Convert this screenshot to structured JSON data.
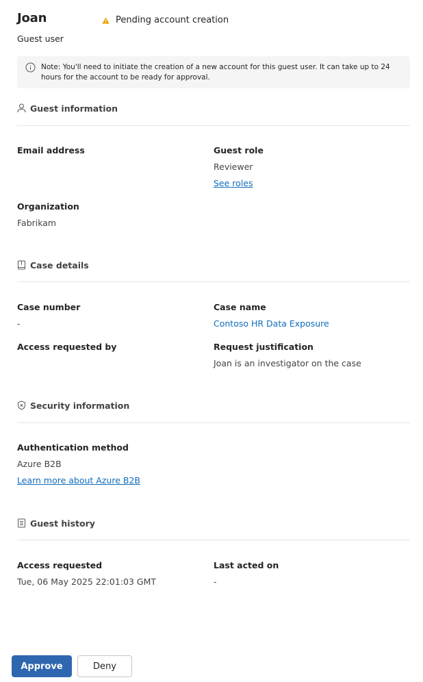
{
  "header": {
    "name": "Joan",
    "status": "Pending account creation",
    "status_icon": "warning-icon",
    "subtitle": "Guest user"
  },
  "notice": {
    "icon": "info-icon",
    "text": "Note: You'll need to initiate the creation of a new account for this guest user. It can take up to 24 hours for the account to be ready for approval."
  },
  "sections": {
    "guest_info": {
      "title": "Guest information",
      "icon": "person-icon",
      "email_label": "Email address",
      "email_value": "",
      "role_label": "Guest role",
      "role_value": "Reviewer",
      "roles_link": "See roles",
      "org_label": "Organization",
      "org_value": "Fabrikam"
    },
    "case_details": {
      "title": "Case details",
      "icon": "book-icon",
      "case_number_label": "Case number",
      "case_number_value": "-",
      "case_name_label": "Case name",
      "case_name_value": "Contoso HR Data Exposure",
      "requested_by_label": "Access requested by",
      "requested_by_value": "",
      "justification_label": "Request justification",
      "justification_value": "Joan is an investigator on the case"
    },
    "security": {
      "title": "Security information",
      "icon": "shield-icon",
      "auth_label": "Authentication method",
      "auth_value": "Azure B2B",
      "learn_more_link": "Learn more about Azure B2B"
    },
    "history": {
      "title": "Guest history",
      "icon": "document-icon",
      "access_requested_label": "Access requested",
      "access_requested_value": "Tue, 06 May 2025 22:01:03 GMT",
      "last_acted_label": "Last acted on",
      "last_acted_value": "-"
    }
  },
  "footer": {
    "approve_label": "Approve",
    "deny_label": "Deny"
  },
  "colors": {
    "accent": "#2f66b0",
    "link": "#0f6cbd",
    "warning": "#eaa300",
    "notice_bg": "#f5f5f5"
  }
}
